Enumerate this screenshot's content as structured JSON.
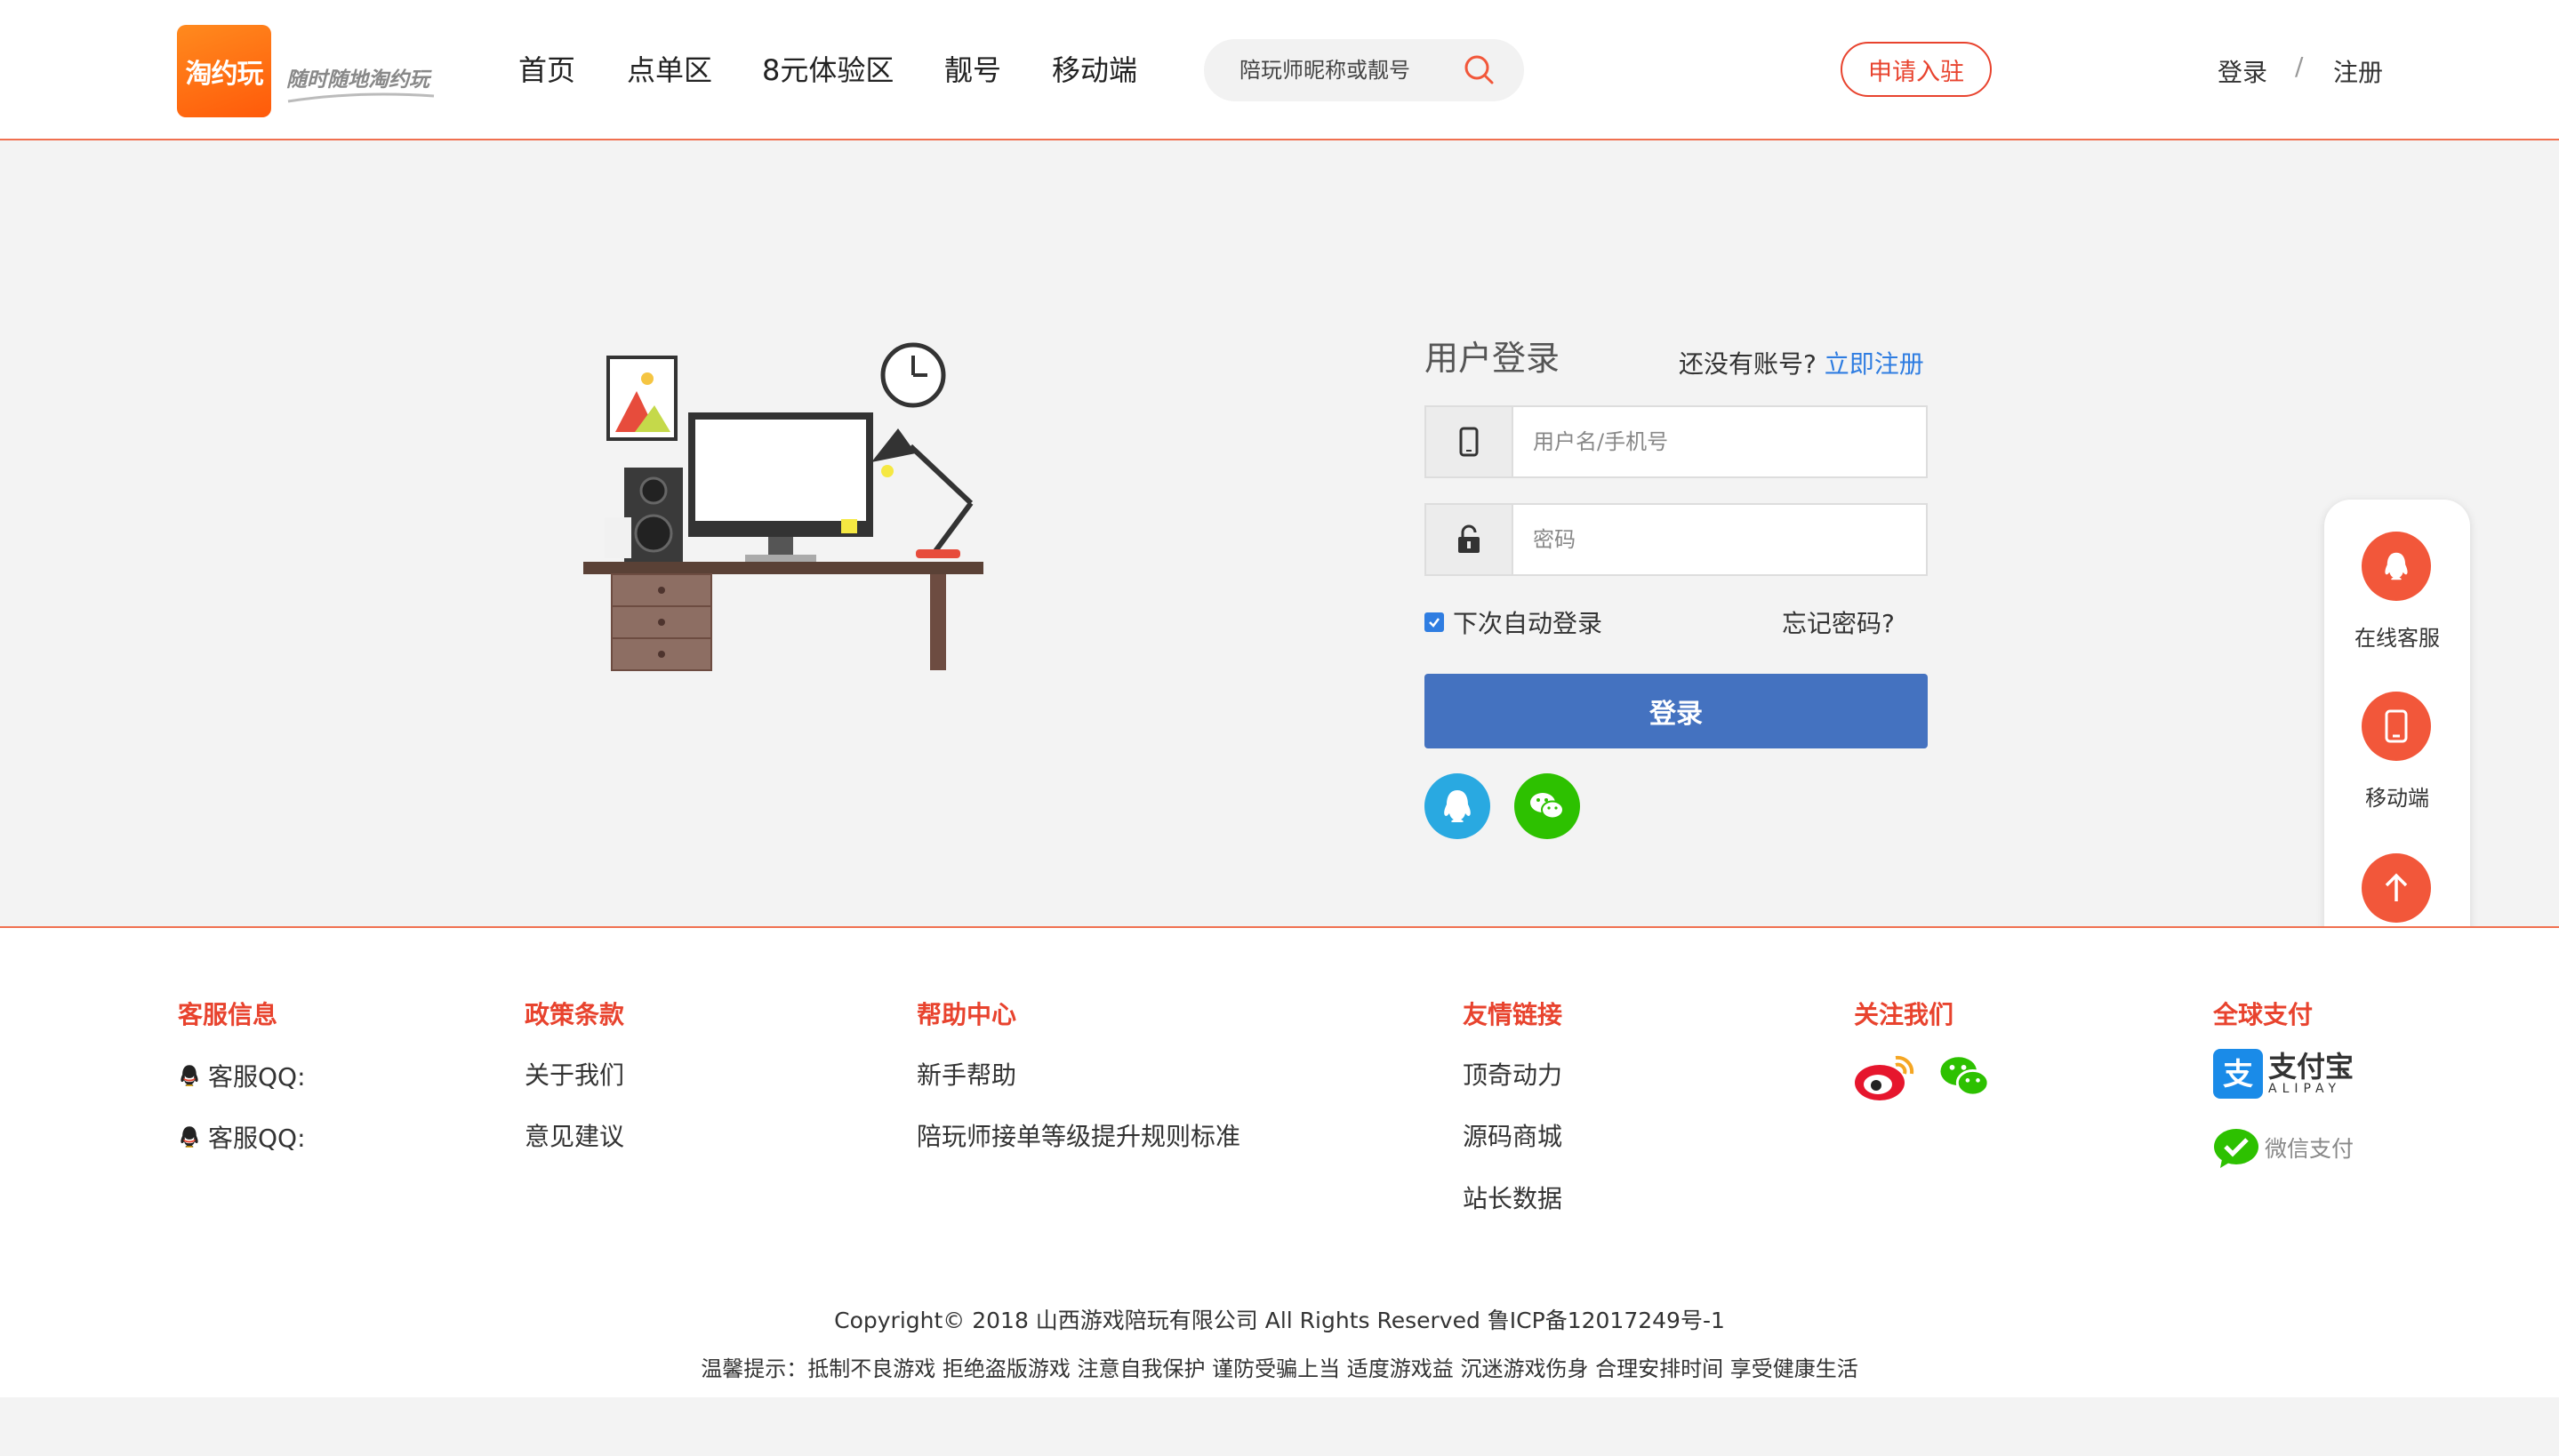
{
  "brand": {
    "logo_text": "淘约玩",
    "slogan": "随时随地淘约玩",
    "accent_color": "#e8432e",
    "primary_color": "#4472c0"
  },
  "nav": {
    "items": [
      {
        "label": "首页"
      },
      {
        "label": "点单区"
      },
      {
        "label": "8元体验区"
      },
      {
        "label": "靓号"
      },
      {
        "label": "移动端"
      }
    ]
  },
  "search": {
    "placeholder": "陪玩师昵称或靓号",
    "icon": "search-icon"
  },
  "header": {
    "apply_label": "申请入驻",
    "login_label": "登录",
    "separator": "/",
    "register_label": "注册"
  },
  "login_form": {
    "title": "用户登录",
    "no_account_text": "还没有账号?",
    "register_now": "立即注册",
    "username_placeholder": "用户名/手机号",
    "username_icon": "phone-icon",
    "password_placeholder": "密码",
    "password_icon": "lock-icon",
    "remember_label": "下次自动登录",
    "remember_checked": true,
    "forgot_label": "忘记密码?",
    "submit_label": "登录",
    "social": [
      {
        "icon": "qq-icon",
        "color": "#29a9e1"
      },
      {
        "icon": "wechat-icon",
        "color": "#2dc100"
      }
    ]
  },
  "float_bar": {
    "items": [
      {
        "label": "在线客服",
        "icon": "qq-icon"
      },
      {
        "label": "移动端",
        "icon": "mobile-icon"
      },
      {
        "label": "",
        "icon": "arrow-up-icon"
      }
    ]
  },
  "footer": {
    "columns": [
      {
        "title": "客服信息",
        "links": [
          "客服QQ:",
          "客服QQ:"
        ]
      },
      {
        "title": "政策条款",
        "links": [
          "关于我们",
          "意见建议"
        ]
      },
      {
        "title": "帮助中心",
        "links": [
          "新手帮助",
          "陪玩师接单等级提升规则标准"
        ]
      },
      {
        "title": "友情链接",
        "links": [
          "顶奇动力",
          "源码商城",
          "站长数据"
        ]
      },
      {
        "title": "关注我们",
        "links": []
      },
      {
        "title": "全球支付",
        "links": []
      }
    ],
    "follow_icons": [
      "weibo-icon",
      "wechat-icon"
    ],
    "payments": {
      "alipay_cn": "支付宝",
      "alipay_en": "ALIPAY",
      "wechat_pay": "微信支付"
    },
    "copyright": "Copyright© 2018 山西游戏陪玩有限公司 All Rights Reserved 鲁ICP备12017249号-1",
    "tips": "温馨提示：抵制不良游戏 拒绝盗版游戏 注意自我保护 谨防受骗上当 适度游戏益 沉迷游戏伤身 合理安排时间 享受健康生活"
  }
}
